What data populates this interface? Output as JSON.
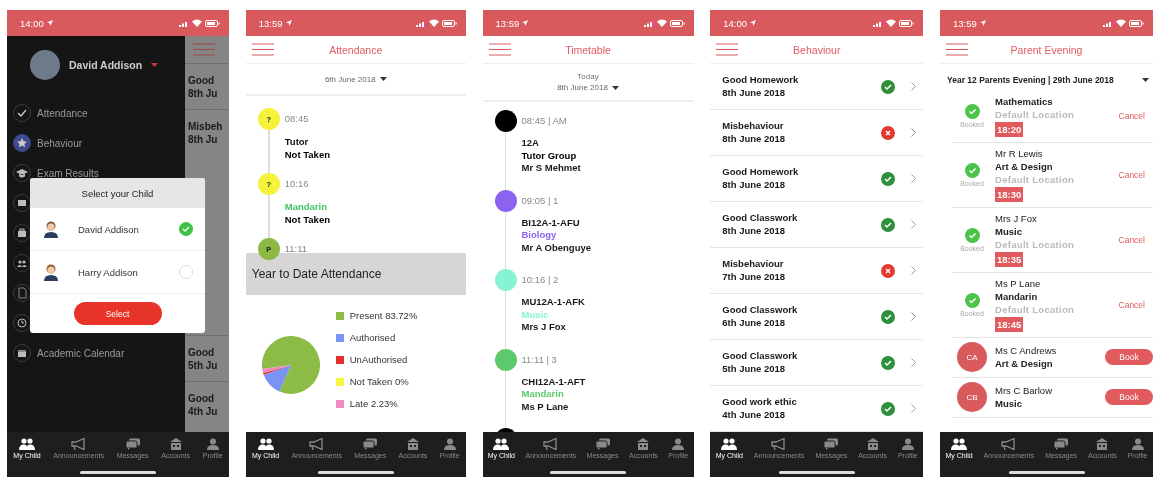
{
  "phones": [
    {
      "kind": "child_select",
      "status": {
        "time": "14:00"
      },
      "drawer": {
        "name": "David Addison",
        "items": [
          {
            "label": "Attendance",
            "selected": false
          },
          {
            "label": "Behaviour",
            "selected": true
          },
          {
            "label": "Exam Results",
            "selected": false
          },
          {
            "selected": false
          },
          {
            "selected": false
          },
          {
            "selected": false
          },
          {
            "selected": false
          },
          {
            "selected": false
          },
          {
            "label": "Academic Calendar",
            "selected": false
          }
        ]
      },
      "background_list": [
        {
          "title": "Good",
          "date": "8th Ju"
        },
        {
          "title": "Misbeh",
          "date": "8th Ju"
        },
        {
          "title": "Good",
          "date": "5th Ju"
        },
        {
          "title": "Good",
          "date": "4th Ju"
        }
      ],
      "dialog": {
        "title": "Select your Child",
        "children": [
          {
            "name": "David Addison",
            "selected": true
          },
          {
            "name": "Harry Addison",
            "selected": false
          }
        ],
        "button": "Select"
      },
      "tabs": [
        {
          "label": "My Child",
          "selected": true
        },
        {
          "label": "Announcements",
          "selected": false
        },
        {
          "label": "Messages",
          "selected": false
        },
        {
          "label": "Accounts",
          "selected": false
        },
        {
          "label": "Profile",
          "selected": false
        }
      ]
    },
    {
      "kind": "attendance",
      "status": {
        "time": "13:59"
      },
      "title": "Attendance",
      "date": "6th June 2018",
      "sessions": [
        {
          "badge": "?",
          "color": "#f5f23a",
          "time": "08:45",
          "subject": {
            "text": "Tutor",
            "color": "#111111"
          },
          "mark": "Not Taken"
        },
        {
          "badge": "?",
          "color": "#f5f23a",
          "time": "10:16",
          "subject": {
            "text": "Mandarin",
            "color": "#3fc463"
          },
          "mark": "Not Taken"
        },
        {
          "badge": "P",
          "color": "#8cb843",
          "time": "11:11"
        }
      ],
      "section_title": "Year to Date Attendance",
      "legend": [
        {
          "color": "#8cbc45"
        },
        {
          "color": "#7b93f5"
        },
        {
          "color": "#e8302a"
        },
        {
          "color": "#f5f542"
        },
        {
          "color": "#f08ac0"
        }
      ],
      "chart_data": {
        "type": "pie",
        "categories": [
          "Present 83.72%",
          "Authorised",
          "UnAuthorised",
          "Not Taken 0%",
          "Late 2.23%"
        ],
        "values": [
          83.72,
          13.0,
          1.05,
          0,
          2.23
        ]
      },
      "tabs": [
        {
          "label": "My Child",
          "selected": true
        },
        {
          "label": "Announcements",
          "selected": false
        },
        {
          "label": "Messages",
          "selected": false
        },
        {
          "label": "Accounts",
          "selected": false
        },
        {
          "label": "Profile",
          "selected": false
        }
      ]
    },
    {
      "kind": "timetable",
      "status": {
        "time": "13:59"
      },
      "title": "Timetable",
      "day": "Today",
      "date": "8th June 2018",
      "lessons": [
        {
          "color": "#000000",
          "time": "08:45 | AM",
          "code": "12A",
          "subject": "Tutor Group",
          "teacher": "Mr S Mehmet"
        },
        {
          "color": "#8b63f0",
          "time": "09:05 | 1",
          "code": "BI12A-1-AFU",
          "subject": "Biology",
          "teacher": "Mr A Obenguye"
        },
        {
          "color": "#86f3d2",
          "time": "10:16 | 2",
          "code": "MU12A-1-AFK",
          "subject": "Music",
          "teacher": "Mrs J Fox"
        },
        {
          "color": "#5cc96c",
          "time": "11:11 | 3",
          "code": "CHI12A-1-AFT",
          "subject": "Mandarin",
          "teacher": "Ms P Lane"
        },
        {
          "color": "#000000"
        }
      ],
      "tabs": [
        {
          "label": "My Child",
          "selected": true
        },
        {
          "label": "Announcements",
          "selected": false
        },
        {
          "label": "Messages",
          "selected": false
        },
        {
          "label": "Accounts",
          "selected": false
        },
        {
          "label": "Profile",
          "selected": false
        }
      ]
    },
    {
      "kind": "behaviour",
      "status": {
        "time": "14:00"
      },
      "title": "Behaviour",
      "records": [
        {
          "title": "Good Homework",
          "date": "8th June 2018",
          "kind": "good"
        },
        {
          "title": "Misbehaviour",
          "date": "8th June 2018",
          "kind": "bad"
        },
        {
          "title": "Good Homework",
          "date": "8th June 2018",
          "kind": "good"
        },
        {
          "title": "Good Classwork",
          "date": "8th June 2018",
          "kind": "good"
        },
        {
          "title": "Misbehaviour",
          "date": "7th June 2018",
          "kind": "bad"
        },
        {
          "title": "Good Classwork",
          "date": "6th June 2018",
          "kind": "good"
        },
        {
          "title": "Good Classwork",
          "date": "5th June 2018",
          "kind": "good"
        },
        {
          "title": "Good work ethic",
          "date": "4th June 2018",
          "kind": "good"
        }
      ],
      "tabs": [
        {
          "label": "My Child",
          "selected": true
        },
        {
          "label": "Announcements",
          "selected": false
        },
        {
          "label": "Messages",
          "selected": false
        },
        {
          "label": "Accounts",
          "selected": false
        },
        {
          "label": "Profile",
          "selected": false
        }
      ]
    },
    {
      "kind": "parent_evening",
      "status": {
        "time": "13:59"
      },
      "title": "Parent Evening",
      "event": "Year 12 Parents Evening | 29th June 2018",
      "appointments": [
        {
          "kind": "booked",
          "status": "Booked",
          "subject": "Mathematics",
          "location": "Default Location",
          "time": "18:20",
          "action": "Cancel"
        },
        {
          "kind": "booked",
          "status": "Booked",
          "teacher": "Mr R Lewis",
          "subject": "Art & Design",
          "location": "Default Location",
          "time": "18:30",
          "action": "Cancel"
        },
        {
          "kind": "booked",
          "status": "Booked",
          "teacher": "Mrs J Fox",
          "subject": "Music",
          "location": "Default Location",
          "time": "18:35",
          "action": "Cancel"
        },
        {
          "kind": "booked",
          "status": "Booked",
          "teacher": "Ms P Lane",
          "subject": "Mandarin",
          "location": "Default Location",
          "time": "18:45",
          "action": "Cancel"
        },
        {
          "kind": "available",
          "initials": "CA",
          "teacher": "Ms C Andrews",
          "subject": "Art & Design",
          "action": "Book"
        },
        {
          "kind": "available",
          "initials": "CB",
          "teacher": "Mrs C Barlow",
          "subject": "Music",
          "action": "Book"
        }
      ],
      "tabs": [
        {
          "label": "My Child",
          "selected": true
        },
        {
          "label": "Announcements",
          "selected": false
        },
        {
          "label": "Messages",
          "selected": false
        },
        {
          "label": "Accounts",
          "selected": false
        },
        {
          "label": "Profile",
          "selected": false
        }
      ]
    }
  ]
}
